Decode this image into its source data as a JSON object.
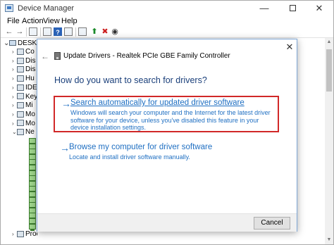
{
  "window": {
    "title": "Device Manager",
    "controls": {
      "minimize": "—",
      "maximize": "",
      "close": "✕"
    }
  },
  "menu": [
    "File",
    "Action",
    "View",
    "Help"
  ],
  "toolbar_icons": [
    "back-arrow-icon",
    "forward-arrow-icon",
    "grid-view-icon",
    "properties-icon",
    "help-icon",
    "grid-view-icon",
    "scan-hardware-icon",
    "update-driver-icon",
    "uninstall-icon",
    "disable-icon"
  ],
  "tree": {
    "root": "DESKTO",
    "nodes": [
      {
        "label": "Co",
        "expanded": false
      },
      {
        "label": "Dis",
        "expanded": false
      },
      {
        "label": "Dis",
        "expanded": false
      },
      {
        "label": "Hu",
        "expanded": false
      },
      {
        "label": "IDE",
        "expanded": false
      },
      {
        "label": "Key",
        "expanded": false
      },
      {
        "label": "Mi",
        "expanded": false
      },
      {
        "label": "Mo",
        "expanded": false
      },
      {
        "label": "Mo",
        "expanded": false
      },
      {
        "label": "Ne",
        "expanded": true
      }
    ],
    "network_adapter_count": 17,
    "bottom_nodes": [
      {
        "label": "Processors"
      }
    ]
  },
  "dialog": {
    "title": "Update Drivers - Realtek PCIe GBE Family Controller",
    "heading": "How do you want to search for drivers?",
    "option1": {
      "title": "Search automatically for updated driver software",
      "description": "Windows will search your computer and the Internet for the latest driver software for your device, unless you've disabled this feature in your device installation settings."
    },
    "option2": {
      "title": "Browse my computer for driver software",
      "description": "Locate and install driver software manually."
    },
    "cancel_label": "Cancel",
    "close_glyph": "✕",
    "back_glyph": "←",
    "arrow_glyph": "→"
  },
  "colors": {
    "link_blue": "#1f6fc2",
    "heading_blue": "#1a3f7a",
    "highlight_red": "#d12828"
  }
}
